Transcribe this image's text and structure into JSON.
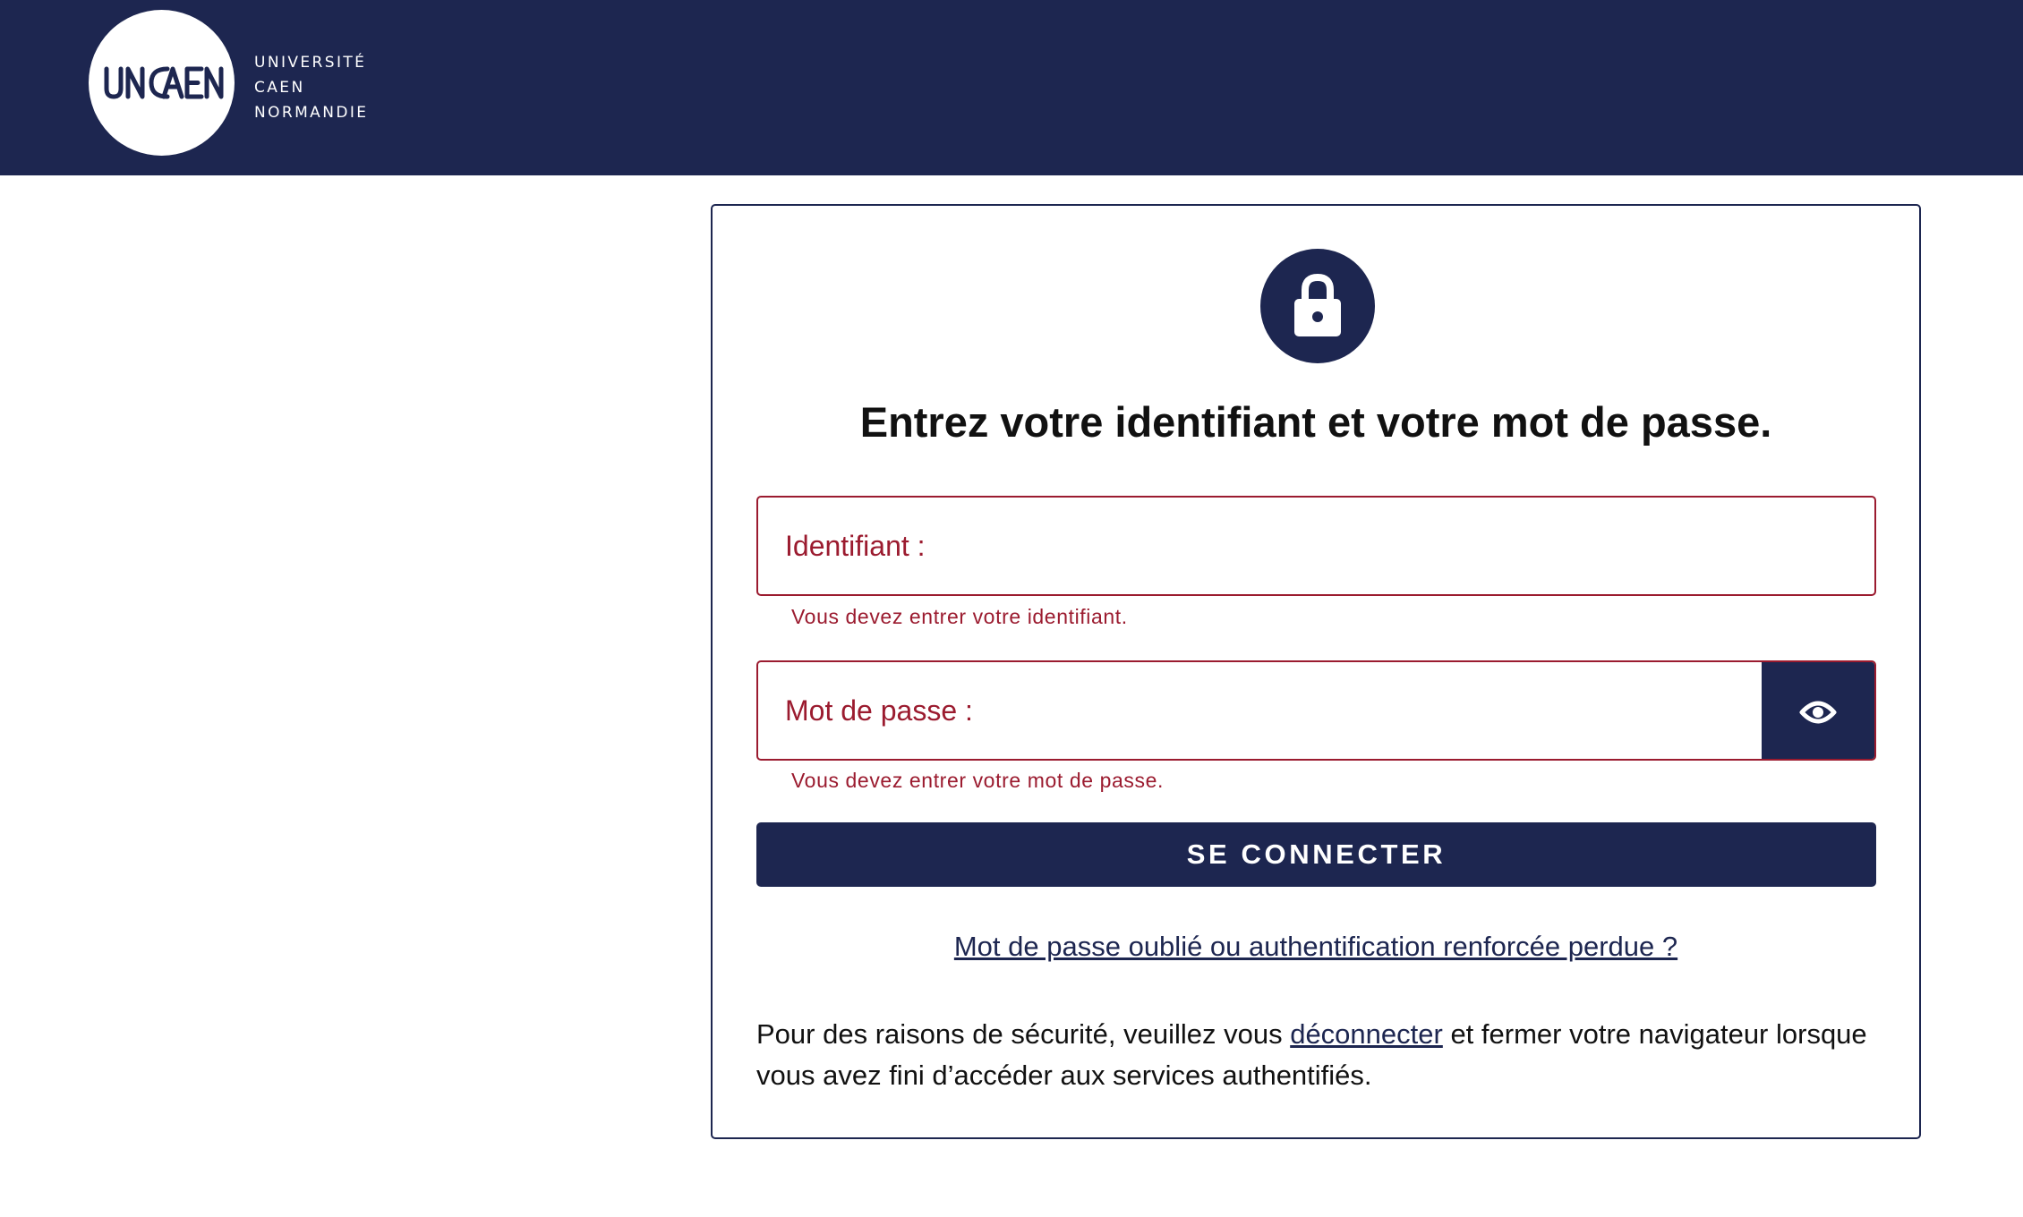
{
  "header": {
    "logo_lines": [
      "UNIVERSITÉ",
      "CAEN",
      "NORMANDIE"
    ],
    "logo_mark_text": "UNICAEN",
    "background": "#1d2650"
  },
  "login": {
    "lock_icon": "lock-icon",
    "title": "Entrez votre identifiant et votre mot de passe.",
    "username": {
      "label": "Identifiant :",
      "value": "",
      "error": "Vous devez entrer votre identifiant."
    },
    "password": {
      "label": "Mot de passe :",
      "value": "",
      "error": "Vous devez entrer votre mot de passe.",
      "toggle_icon": "eye-icon"
    },
    "submit_label": "SE CONNECTER",
    "forgot_link": "Mot de passe oublié ou authentification renforcée perdue ?",
    "notice": {
      "before": "Pour des raisons de sécurité, veuillez vous ",
      "link": "déconnecter",
      "after": " et fermer votre navigateur lorsque vous avez fini d’accéder aux services authentifiés."
    }
  },
  "colors": {
    "brand": "#1d2650",
    "error": "#9b1b2f",
    "text": "#111111"
  }
}
